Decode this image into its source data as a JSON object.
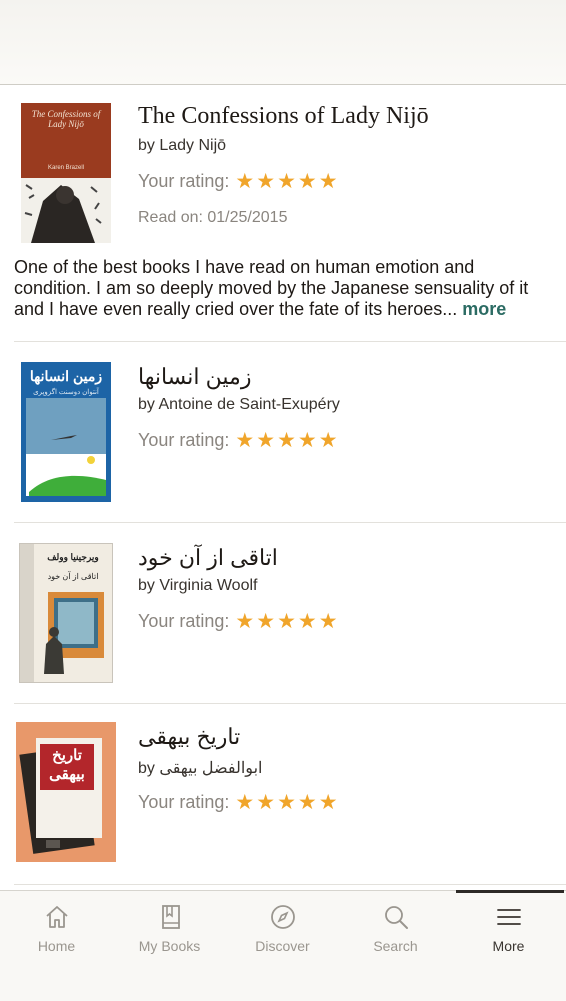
{
  "books": [
    {
      "title": "The Confessions of Lady Nijō",
      "author": "by Lady Nijō",
      "rating_label": "Your rating:",
      "stars": 5,
      "read_on": "Read on: 01/25/2015",
      "review": "One of the best books I have read on human emotion and condition. I am so deeply moved by the Japanese sensuality of it and I have even really cried over the fate of its heroes...",
      "more": "more",
      "cover": {
        "title": "The Confessions of Lady Nijō",
        "author": "Karen Brazell"
      }
    },
    {
      "title": "زمین انسانها",
      "author": "by Antoine de Saint-Exupéry",
      "rating_label": "Your rating:",
      "stars": 5,
      "cover": {
        "title": "زمین انسانها",
        "author": "آنتوان دوسنت اگزوپری"
      }
    },
    {
      "title": "اتاقی از آن خود",
      "author": "by Virginia Woolf",
      "rating_label": "Your rating:",
      "stars": 5,
      "cover": {
        "title": "اتاقی از آن خود",
        "author": "ویرجینیا وولف"
      }
    },
    {
      "title": "تاریخ بیهقی",
      "author_prefix": "by",
      "author_name": "ابوالفضل بیهقی",
      "rating_label": "Your rating:",
      "stars": 5,
      "cover": {
        "title": "تاریخ بیهقی"
      }
    }
  ],
  "tabs": [
    {
      "label": "Home",
      "icon": "home-icon"
    },
    {
      "label": "My Books",
      "icon": "book-icon"
    },
    {
      "label": "Discover",
      "icon": "compass-icon"
    },
    {
      "label": "Search",
      "icon": "search-icon"
    },
    {
      "label": "More",
      "icon": "menu-icon",
      "active": true
    }
  ],
  "colors": {
    "star": "#f0a52b",
    "link": "#2b6b63",
    "text": "#1e1915",
    "muted": "#8a857f"
  }
}
